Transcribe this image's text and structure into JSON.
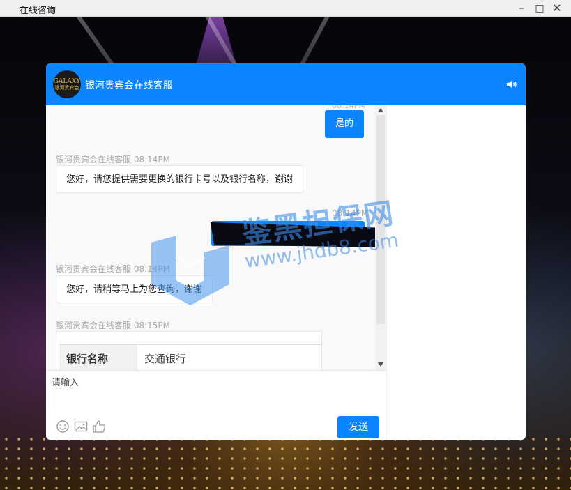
{
  "window": {
    "title": "在线咨询",
    "controls": [
      "minimize",
      "maximize",
      "close"
    ]
  },
  "chat": {
    "header_title": "银河贵宾会在线客服",
    "logo_text_top": "GALAXY",
    "logo_text_bottom": "银河贵宾会",
    "messages": [
      {
        "from": "user",
        "text": "是的"
      },
      {
        "from": "service",
        "meta": "银河贵宾会在线客服 08:14PM",
        "text": "您好，请您提供需要更换的银行卡号以及银行名称，谢谢"
      },
      {
        "from": "user",
        "meta": "08:14PM",
        "text": ""
      },
      {
        "from": "service",
        "meta": "银河贵宾会在线客服 08:14PM",
        "text": "您好，请稍等马上为您查询，谢谢"
      },
      {
        "from": "service",
        "meta": "银河贵宾会在线客服 08:15PM",
        "card": {
          "key": "银行名称",
          "value": "交通银行"
        }
      }
    ],
    "input_placeholder": "请输入",
    "send_label": "发送",
    "tools": [
      "emoji-icon",
      "image-icon",
      "thumbs-up-icon"
    ],
    "accent_color": "#0a84ff"
  },
  "watermark": {
    "text": "鉴黑担保网",
    "url": "www.jhdb8.com"
  }
}
